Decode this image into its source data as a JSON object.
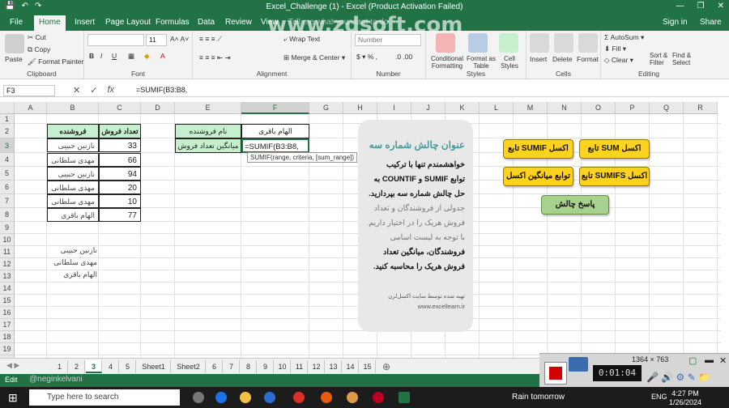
{
  "titlebar": {
    "title": "Excel_Challenge (1) - Excel (Product Activation Failed)",
    "controls": [
      "—",
      "❐",
      "✕"
    ]
  },
  "tabs": [
    "File",
    "Home",
    "Insert",
    "Page Layout",
    "Formulas",
    "Data",
    "Review",
    "View",
    "Tell me what you want to do"
  ],
  "tabs_right": {
    "signin": "Sign in",
    "share": "Share"
  },
  "watermark": "www.zdsoft.com",
  "ribbon": {
    "clipboard": {
      "paste": "Paste",
      "cut": "Cut",
      "copy": "Copy",
      "format_painter": "Format Painter",
      "name": "Clipboard"
    },
    "font": {
      "size": "11",
      "name": "Font"
    },
    "alignment": {
      "wrap": "Wrap Text",
      "merge": "Merge & Center",
      "name": "Alignment"
    },
    "number": {
      "format": "Number",
      "name": "Number"
    },
    "styles": {
      "conditional": "Conditional Formatting",
      "format_table": "Format as Table",
      "cell_styles": "Cell Styles",
      "name": "Styles"
    },
    "cells": {
      "insert": "Insert",
      "delete": "Delete",
      "format": "Format",
      "name": "Cells"
    },
    "editing": {
      "autosum": "AutoSum",
      "fill": "Fill",
      "clear": "Clear",
      "sort": "Sort & Filter",
      "find": "Find & Select",
      "name": "Editing"
    }
  },
  "formula_bar": {
    "namebox": "F3",
    "formula": "=SUMIF(B3:B8,"
  },
  "columns": [
    "A",
    "B",
    "C",
    "D",
    "E",
    "F",
    "G",
    "H",
    "I",
    "J",
    "K",
    "L",
    "M",
    "N",
    "O",
    "P",
    "Q",
    "R"
  ],
  "rows": [
    "1",
    "2",
    "3",
    "4",
    "5",
    "6",
    "7",
    "8",
    "9",
    "10",
    "11",
    "12",
    "13",
    "14",
    "15",
    "16",
    "17",
    "18",
    "19",
    "20"
  ],
  "table1": {
    "header_name": "فروشنده",
    "header_count": "تعداد فروش",
    "names": [
      "نازنین حبیبی",
      "مهدی سلطانی",
      "نازنین حبیبی",
      "مهدی سلطانی",
      "مهدی سلطانی",
      "الهام باقری"
    ],
    "counts": [
      "33",
      "66",
      "94",
      "20",
      "10",
      "77"
    ]
  },
  "table2": {
    "label_seller": "نام فروشنده",
    "value_seller": "الهام باقری",
    "label_avg": "میانگین تعداد فروش",
    "value_avg": "=SUMIF(B3:B8,"
  },
  "tooltip": "SUMIF(range, criteria, [sum_range])",
  "unique_names": [
    "نازنین حبیبی",
    "مهدی سلطانی",
    "الهام باقری"
  ],
  "panel": {
    "title": "عنوان چالش شماره سه",
    "bold_lines": [
      "خواهشمندم تنها با ترکیب",
      "توابع SUMIF و COUNTIF به",
      "حل چالش شماره سه بپردازید."
    ],
    "body_lines": [
      "جدولی از فروشندگان و تعداد",
      "فروش هریک را در اختیار داریم.",
      "با توجه به لیست اسامی",
      "فروشندگان، میانگین تعداد",
      "فروش هریک را محاسبه کنید."
    ],
    "footer1": "تهیه شده توسط سایت اکسل‌لرن",
    "footer2": "www.excellearn.ir"
  },
  "buttons": {
    "sum": "تابع SUM اکسل",
    "sumif": "تابع SUMIF اکسل",
    "sumifs": "تابع SUMIFS اکسل",
    "average": "توابع میانگین اکسل",
    "answer": "پاسخ چالش"
  },
  "sheet_tabs": [
    "1",
    "2",
    "3",
    "4",
    "5",
    "Sheet1",
    "Sheet2",
    "6",
    "7",
    "8",
    "9",
    "10",
    "11",
    "12",
    "13",
    "14",
    "15"
  ],
  "active_sheet": "3",
  "status": "Edit",
  "recorder": {
    "size": "1364 × 763",
    "time": "0:01:04"
  },
  "user_tag": "@neginkelvani",
  "taskbar": {
    "search": "Type here to search",
    "weather": "Rain tomorrow",
    "lang": "ENG",
    "time": "4:27 PM",
    "date": "1/26/2024"
  }
}
